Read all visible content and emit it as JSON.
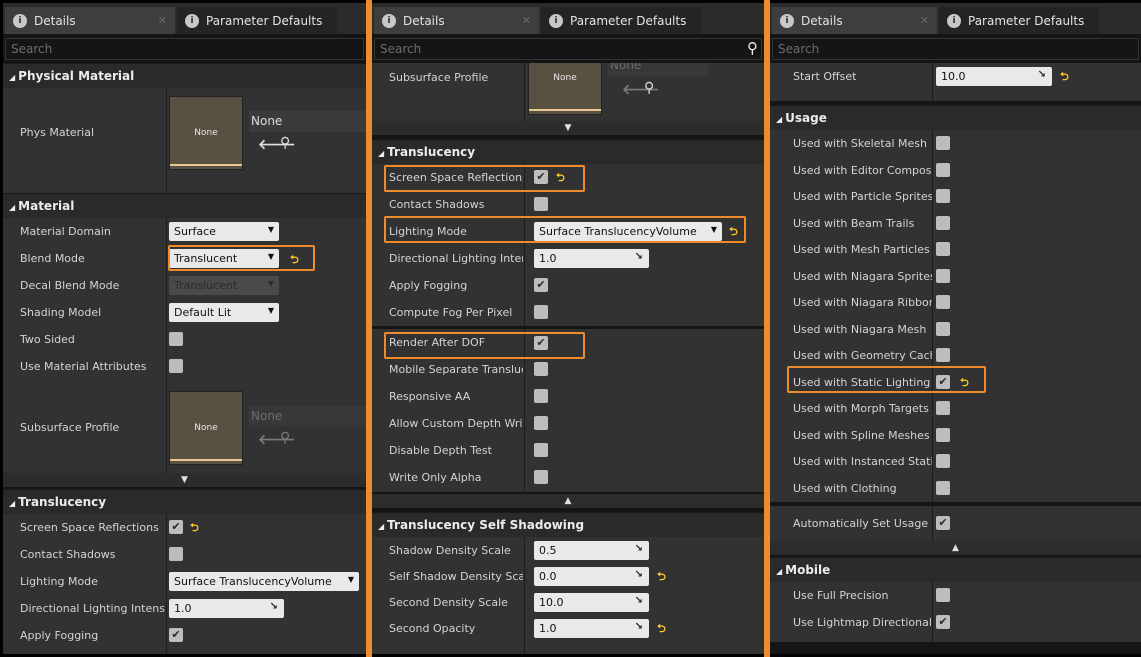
{
  "tabs": {
    "details": "Details",
    "params": "Parameter Defaults"
  },
  "icons": {
    "tab": "info-icon",
    "close": "close-icon",
    "search": "search-icon",
    "arrow": "arrow-left-icon",
    "browse": "magnifier-icon",
    "reset": "reset-arrow-icon",
    "check": "checkmark-icon"
  },
  "search": {
    "placeholder": "Search"
  },
  "colors": {
    "highlight": "#ee8b2b",
    "reset_arrow": "#ffcf2a"
  },
  "p1": {
    "physical_material": "Physical Material",
    "phys_material": "Phys Material",
    "none": "None",
    "material": "Material",
    "material_domain": "Material Domain",
    "material_domain_val": "Surface",
    "blend_mode": "Blend Mode",
    "blend_mode_val": "Translucent",
    "decal_blend_mode": "Decal Blend Mode",
    "decal_blend_mode_val": "Translucent",
    "shading_model": "Shading Model",
    "shading_model_val": "Default Lit",
    "two_sided": "Two Sided",
    "use_material_attributes": "Use Material Attributes",
    "subsurface_profile": "Subsurface Profile",
    "translucency": "Translucency",
    "ssr": "Screen Space Reflections",
    "contact_shadows": "Contact Shadows",
    "lighting_mode": "Lighting Mode",
    "lighting_mode_val": "Surface TranslucencyVolume",
    "directional_lighting": "Directional Lighting Intensity",
    "directional_lighting_val": "1.0",
    "apply_fogging": "Apply Fogging"
  },
  "p2": {
    "subsurface_profile": "Subsurface Profile",
    "none": "None",
    "translucency": "Translucency",
    "ssr": "Screen Space Reflections",
    "contact_shadows": "Contact Shadows",
    "lighting_mode": "Lighting Mode",
    "lighting_mode_val": "Surface TranslucencyVolume",
    "directional_lighting": "Directional Lighting Intensity",
    "directional_lighting_val": "1.0",
    "apply_fogging": "Apply Fogging",
    "compute_fog": "Compute Fog Per Pixel",
    "render_after_dof": "Render After DOF",
    "mobile_separate": "Mobile Separate Translucency",
    "responsive_aa": "Responsive AA",
    "allow_custom_depth": "Allow Custom Depth Writes",
    "disable_depth_test": "Disable Depth Test",
    "write_only_alpha": "Write Only Alpha",
    "self_shadowing": "Translucency Self Shadowing",
    "shadow_density_scale": "Shadow Density Scale",
    "shadow_density_scale_val": "0.5",
    "self_shadow_density": "Self Shadow Density Scale",
    "self_shadow_density_val": "0.0",
    "second_density_scale": "Second Density Scale",
    "second_density_scale_val": "10.0",
    "second_opacity": "Second Opacity",
    "second_opacity_val": "1.0"
  },
  "p3": {
    "start_offset": "Start Offset",
    "start_offset_val": "10.0",
    "usage": "Usage",
    "usage_items": [
      "Used with Skeletal Mesh",
      "Used with Editor Compositing",
      "Used with Particle Sprites",
      "Used with Beam Trails",
      "Used with Mesh Particles",
      "Used with Niagara Sprites",
      "Used with Niagara Ribbons",
      "Used with Niagara Mesh",
      "Used with Geometry Cache",
      "Used with Static Lighting",
      "Used with Morph Targets",
      "Used with Spline Meshes",
      "Used with Instanced Static Meshes",
      "Used with Clothing"
    ],
    "auto_usage": "Automatically Set Usage",
    "mobile": "Mobile",
    "full_precision": "Use Full Precision",
    "lightmap_directional": "Use Lightmap Directionality"
  }
}
